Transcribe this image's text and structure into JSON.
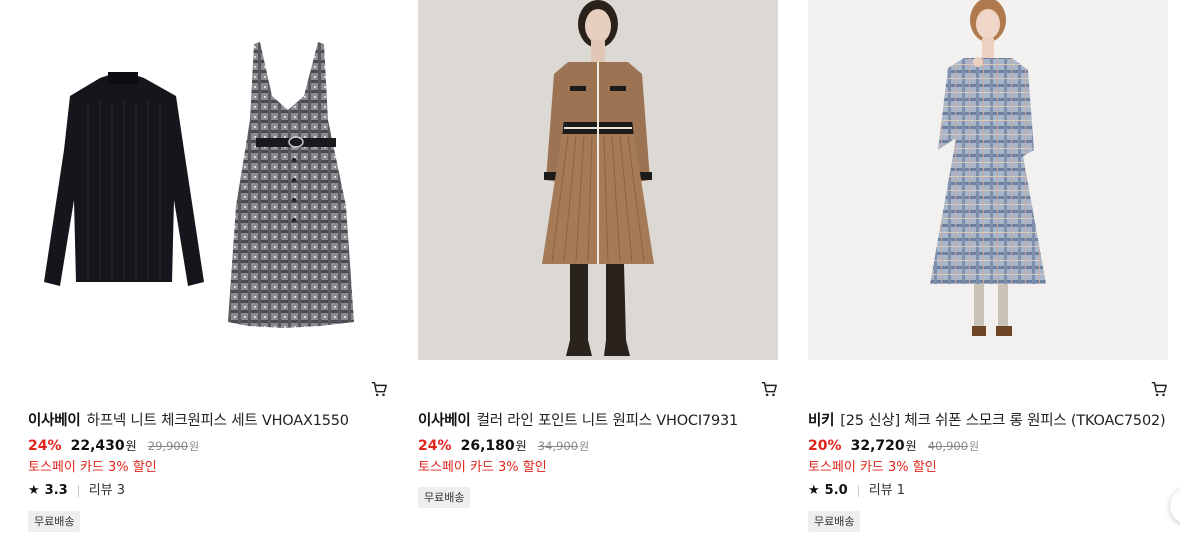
{
  "products": [
    {
      "brand": "이사베이",
      "name": "하프넥 니트 체크원피스 세트 VHOAX1550",
      "discount": "24%",
      "price": "22,430",
      "price_unit": "원",
      "original_price": "29,900",
      "original_unit": "원",
      "promo": "토스페이 카드 3% 할인",
      "rating": "3.3",
      "reviews": "리뷰 3",
      "badge": "무료배송",
      "image_desc_icon": "knit-and-check-dress-set-image"
    },
    {
      "brand": "이사베이",
      "name": "컬러 라인 포인트 니트 원피스 VHOCI7931",
      "discount": "24%",
      "price": "26,180",
      "price_unit": "원",
      "original_price": "34,900",
      "original_unit": "원",
      "promo": "토스페이 카드 3% 할인",
      "badge": "무료배송",
      "image_desc_icon": "brown-knit-dress-model-image"
    },
    {
      "brand": "비키",
      "name": "[25 신상] 체크 쉬폰 스모크 롱 원피스 (TKOAC7502)",
      "discount": "20%",
      "price": "32,720",
      "price_unit": "원",
      "original_price": "40,900",
      "original_unit": "원",
      "promo": "토스페이 카드 3% 할인",
      "rating": "5.0",
      "reviews": "리뷰 1",
      "badge": "무료배송",
      "image_desc_icon": "blue-check-chiffon-dress-model-image"
    }
  ],
  "colors": {
    "accent_red": "#e0251b",
    "badge_bg": "#eeeeee"
  },
  "icons": {
    "cart": "cart-icon",
    "star": "star-icon"
  }
}
